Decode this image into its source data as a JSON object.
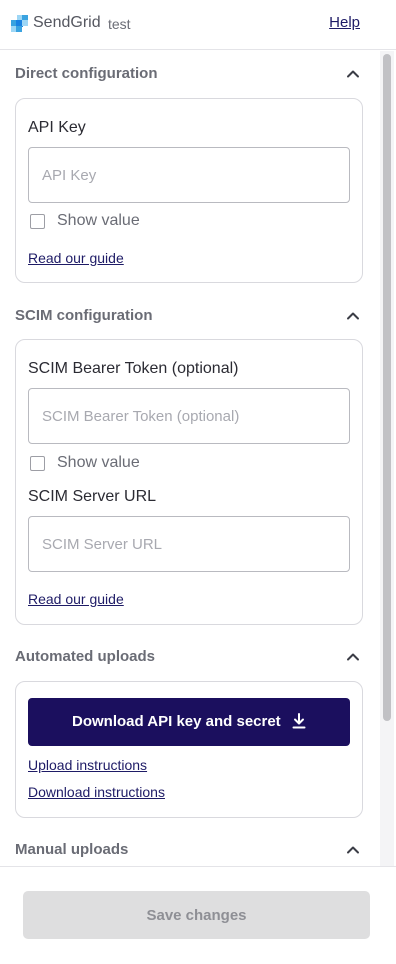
{
  "header": {
    "brand": "SendGrid",
    "environment": "test",
    "help_label": "Help"
  },
  "sections": {
    "direct": {
      "title": "Direct configuration",
      "api_key_label": "API Key",
      "api_key_placeholder": "API Key",
      "show_value_label": "Show value",
      "guide_link": "Read our guide"
    },
    "scim": {
      "title": "SCIM configuration",
      "token_label": "SCIM Bearer Token (optional)",
      "token_placeholder": "SCIM Bearer Token (optional)",
      "show_value_label": "Show value",
      "server_url_label": "SCIM Server URL",
      "server_url_placeholder": "SCIM Server URL",
      "guide_link": "Read our guide"
    },
    "automated": {
      "title": "Automated uploads",
      "download_button": "Download API key and secret",
      "upload_instructions": "Upload instructions",
      "download_instructions": "Download instructions"
    },
    "manual": {
      "title": "Manual uploads"
    }
  },
  "footer": {
    "save_label": "Save changes"
  },
  "colors": {
    "primary": "#1b0f5e",
    "link": "#1e1b66",
    "disabled_bg": "#dededf"
  },
  "icons": [
    "sendgrid-logo-icon",
    "chevron-up-icon",
    "checkbox-icon",
    "download-icon"
  ]
}
